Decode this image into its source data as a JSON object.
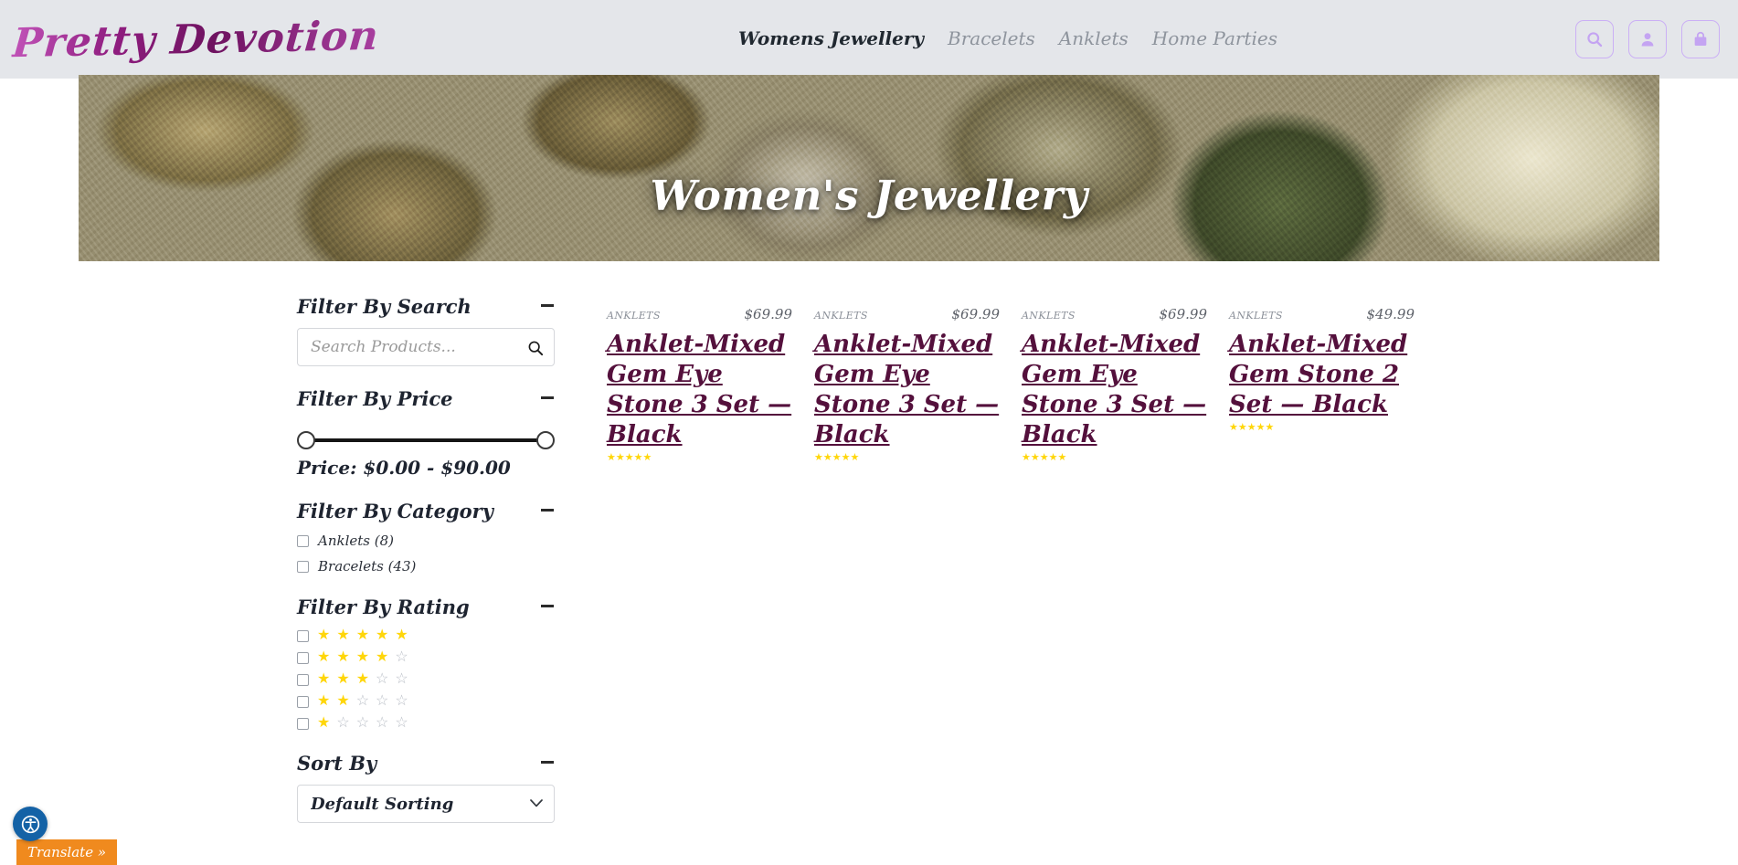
{
  "header": {
    "logo_text": "Pretty Devotion",
    "nav": [
      {
        "label": "Womens Jewellery",
        "active": true
      },
      {
        "label": "Bracelets",
        "active": false
      },
      {
        "label": "Anklets",
        "active": false
      },
      {
        "label": "Home Parties",
        "active": false
      }
    ],
    "actions": [
      {
        "name": "search-icon",
        "label": "Search"
      },
      {
        "name": "account-icon",
        "label": "My Account"
      },
      {
        "name": "cart-bag-icon",
        "label": "Cart"
      }
    ],
    "accent_color": "#8f1d7f",
    "icon_button_border": "#cbb0f5",
    "background_color": "#e4e6ea"
  },
  "hero": {
    "title": "Women's Jewellery"
  },
  "sidebar": {
    "search_widget": {
      "title": "Filter By Search",
      "placeholder": "Search Products...",
      "value": "",
      "collapse_symbol": "−"
    },
    "price_widget": {
      "title": "Filter By Price",
      "label": "Price: $0.00 - $90.00",
      "min": "$0.00",
      "max": "$90.00",
      "collapse_symbol": "−"
    },
    "category_widget": {
      "title": "Filter By Category",
      "collapse_symbol": "−",
      "items": [
        {
          "label": "Anklets (8)",
          "checked": false
        },
        {
          "label": "Bracelets (43)",
          "checked": false
        }
      ]
    },
    "rating_widget": {
      "title": "Filter By Rating",
      "collapse_symbol": "−",
      "rows": [
        {
          "filled": 5
        },
        {
          "filled": 4
        },
        {
          "filled": 3
        },
        {
          "filled": 2
        },
        {
          "filled": 1
        }
      ],
      "star_on_color": "#ffd60a",
      "star_off_color": "#b9bec6"
    },
    "sort_widget": {
      "title": "Sort By",
      "selected": "Default Sorting",
      "collapse_symbol": "−"
    }
  },
  "products": [
    {
      "category": "ANKLETS",
      "price": "$69.99",
      "title": "Anklet-Mixed Gem Eye Stone 3 Set — Black",
      "rating": 5,
      "image": "burlap-pillow-evil-eye-bracelets"
    },
    {
      "category": "ANKLETS",
      "price": "$69.99",
      "title": "Anklet-Mixed Gem Eye Stone 3 Set — Black",
      "rating": 5,
      "image": "burlap-pillow-hamsa-bracelets-white-lace"
    },
    {
      "category": "ANKLETS",
      "price": "$69.99",
      "title": "Anklet-Mixed Gem Eye Stone 3 Set — Black",
      "rating": 5,
      "image": "burlap-pillow-hamsa-bracelets-roses"
    },
    {
      "category": "ANKLETS",
      "price": "$49.99",
      "title": "Anklet-Mixed Gem Stone 2 Set — Black",
      "rating": 5,
      "image": "burlap-pillow-bracelets-cream-roses"
    },
    {
      "category": "",
      "price": "",
      "title": "",
      "rating": 0,
      "image": "cream-roses-burlap-basket"
    },
    {
      "category": "",
      "price": "",
      "title": "",
      "rating": 0,
      "image": "white-damask-burlap-pillow"
    },
    {
      "category": "",
      "price": "",
      "title": "",
      "rating": 0,
      "image": "cream-roses-closeup"
    },
    {
      "category": "",
      "price": "",
      "title": "",
      "rating": 0,
      "image": "cream-roses-burlap-wrap"
    }
  ],
  "floating": {
    "accessibility_label": "Accessibility",
    "translate_label": "Translate »"
  }
}
